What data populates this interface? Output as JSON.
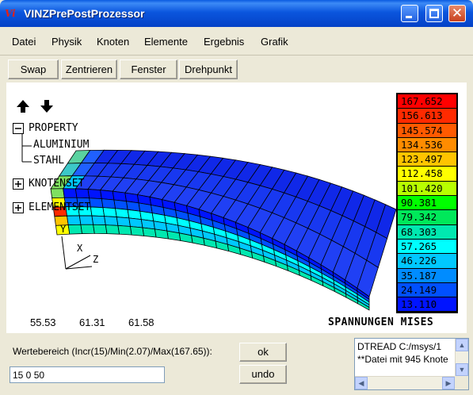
{
  "window": {
    "title": "VINZPrePostProzessor",
    "icon_text": "Vi"
  },
  "menu": [
    "Datei",
    "Physik",
    "Knoten",
    "Elemente",
    "Ergebnis",
    "Grafik"
  ],
  "toolbar": [
    "Swap",
    "Zentrieren",
    "Fenster",
    "Drehpunkt"
  ],
  "tree": {
    "property": "PROPERTY",
    "materials": [
      "ALUMINIUM",
      "STAHL"
    ],
    "knotenset": "KNOTENSET",
    "elementset": "ELEMENTSET"
  },
  "axes": {
    "x": "X",
    "y": "Y",
    "z": "Z"
  },
  "values": [
    "55.53",
    "61.31",
    "61.58"
  ],
  "result_label": "SPANNUNGEN MISES",
  "legend": [
    {
      "value": "167.652",
      "color": "#FF0000"
    },
    {
      "value": "156.613",
      "color": "#FF2A00"
    },
    {
      "value": "145.574",
      "color": "#FF5A00"
    },
    {
      "value": "134.536",
      "color": "#FF8C00"
    },
    {
      "value": "123.497",
      "color": "#FFC400"
    },
    {
      "value": "112.458",
      "color": "#FFFF00"
    },
    {
      "value": "101.420",
      "color": "#B8FF00"
    },
    {
      "value": "90.381",
      "color": "#00FF00"
    },
    {
      "value": "79.342",
      "color": "#00E85A"
    },
    {
      "value": "68.303",
      "color": "#00E8B0"
    },
    {
      "value": "57.265",
      "color": "#00FFFF"
    },
    {
      "value": "46.226",
      "color": "#00C8FF"
    },
    {
      "value": "35.187",
      "color": "#008CFF"
    },
    {
      "value": "24.149",
      "color": "#0050FF"
    },
    {
      "value": "13.110",
      "color": "#0014FF"
    }
  ],
  "range": {
    "label": "Wertebereich (Incr(15)/Min(2.07)/Max(167.65)):",
    "input_value": "15 0 50"
  },
  "buttons": {
    "ok": "ok",
    "undo": "undo"
  },
  "log": [
    "DTREAD C:/msys/1",
    "**Datei mit 945 Knote"
  ]
}
